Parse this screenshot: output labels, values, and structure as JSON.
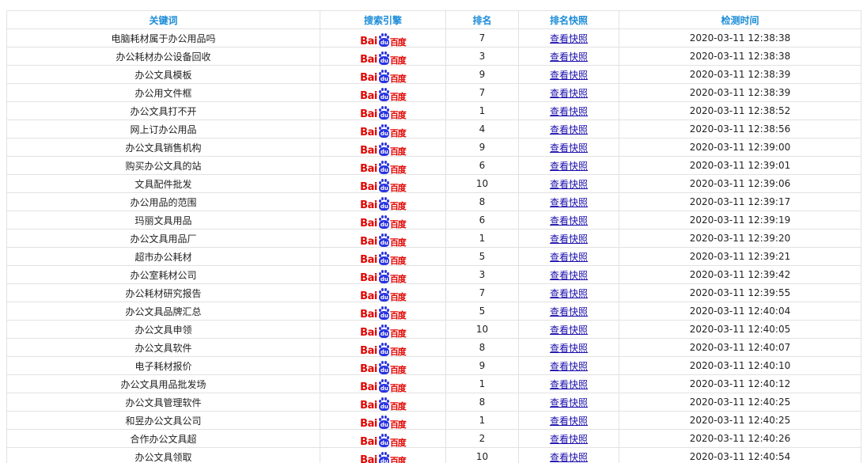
{
  "table": {
    "headers": [
      "关键词",
      "搜索引擎",
      "排名",
      "排名快照",
      "检测时间"
    ],
    "engine_logo": {
      "latin": "Bai",
      "paw": "du",
      "chinese": "百度"
    },
    "snapshot_label": "查看快照",
    "colors": {
      "header": "#1a8cd8",
      "link": "#1a0dab",
      "baidu_red": "#e10602",
      "baidu_blue": "#2932e1"
    },
    "rows": [
      {
        "keyword": "电脑耗材属于办公用品吗",
        "rank": "7",
        "time": "2020-03-11 12:38:38"
      },
      {
        "keyword": "办公耗材办公设备回收",
        "rank": "3",
        "time": "2020-03-11 12:38:38"
      },
      {
        "keyword": "办公文具模板",
        "rank": "9",
        "time": "2020-03-11 12:38:39"
      },
      {
        "keyword": "办公用文件框",
        "rank": "7",
        "time": "2020-03-11 12:38:39"
      },
      {
        "keyword": "办公文具打不开",
        "rank": "1",
        "time": "2020-03-11 12:38:52"
      },
      {
        "keyword": "网上订办公用品",
        "rank": "4",
        "time": "2020-03-11 12:38:56"
      },
      {
        "keyword": "办公文具销售机构",
        "rank": "9",
        "time": "2020-03-11 12:39:00"
      },
      {
        "keyword": "购买办公文具的站",
        "rank": "6",
        "time": "2020-03-11 12:39:01"
      },
      {
        "keyword": "文具配件批发",
        "rank": "10",
        "time": "2020-03-11 12:39:06"
      },
      {
        "keyword": "办公用品的范围",
        "rank": "8",
        "time": "2020-03-11 12:39:17"
      },
      {
        "keyword": "玛丽文具用品",
        "rank": "6",
        "time": "2020-03-11 12:39:19"
      },
      {
        "keyword": "办公文具用品厂",
        "rank": "1",
        "time": "2020-03-11 12:39:20"
      },
      {
        "keyword": "超市办公耗材",
        "rank": "5",
        "time": "2020-03-11 12:39:21"
      },
      {
        "keyword": "办公室耗材公司",
        "rank": "3",
        "time": "2020-03-11 12:39:42"
      },
      {
        "keyword": "办公耗材研究报告",
        "rank": "7",
        "time": "2020-03-11 12:39:55"
      },
      {
        "keyword": "办公文具品牌汇总",
        "rank": "5",
        "time": "2020-03-11 12:40:04"
      },
      {
        "keyword": "办公文具申领",
        "rank": "10",
        "time": "2020-03-11 12:40:05"
      },
      {
        "keyword": "办公文具软件",
        "rank": "8",
        "time": "2020-03-11 12:40:07"
      },
      {
        "keyword": "电子耗材报价",
        "rank": "9",
        "time": "2020-03-11 12:40:10"
      },
      {
        "keyword": "办公文具用品批发场",
        "rank": "1",
        "time": "2020-03-11 12:40:12"
      },
      {
        "keyword": "办公文具管理软件",
        "rank": "8",
        "time": "2020-03-11 12:40:25"
      },
      {
        "keyword": "和昱办公文具公司",
        "rank": "1",
        "time": "2020-03-11 12:40:25"
      },
      {
        "keyword": "合作办公文具超",
        "rank": "2",
        "time": "2020-03-11 12:40:26"
      },
      {
        "keyword": "办公文具领取",
        "rank": "10",
        "time": "2020-03-11 12:40:54"
      }
    ]
  }
}
